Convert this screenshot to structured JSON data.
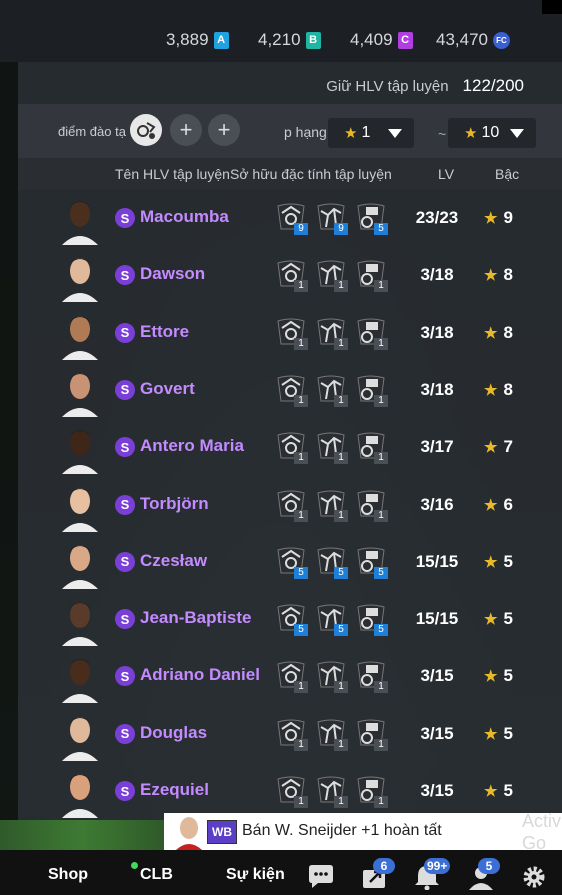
{
  "currencies": [
    {
      "value": "3,889",
      "icon": "A",
      "color": "#1fa3e0"
    },
    {
      "value": "4,210",
      "icon": "B",
      "color": "#1fb5a5"
    },
    {
      "value": "4,409",
      "icon": "C",
      "color": "#b03ee0"
    },
    {
      "value": "43,470",
      "icon": "FC",
      "color": "#3a5fd0"
    }
  ],
  "header": {
    "label": "Giữ HLV tập luyện",
    "count": "122/200"
  },
  "filter": {
    "label": "điểm đào tạ",
    "rank_label": "p hạng",
    "from_value": "1",
    "to_value": "10",
    "separator": "~"
  },
  "columns": {
    "name": "Tên HLV tập luyện",
    "traits": "Sở hữu đặc tính tập luyện",
    "lv": "LV",
    "rank": "Bậc"
  },
  "coaches": [
    {
      "name": "Macoumba",
      "badge": "S",
      "traits": [
        {
          "lvl": "9",
          "c": "#1f7fd6"
        },
        {
          "lvl": "9",
          "c": "#1f7fd6"
        },
        {
          "lvl": "5",
          "c": "#1f7fd6"
        }
      ],
      "lv": "23/23",
      "rank": "9",
      "skin": "#4a2e1e"
    },
    {
      "name": "Dawson",
      "badge": "S",
      "traits": [
        {
          "lvl": "1",
          "c": "#4a4e55"
        },
        {
          "lvl": "1",
          "c": "#4a4e55"
        },
        {
          "lvl": "1",
          "c": "#4a4e55"
        }
      ],
      "lv": "3/18",
      "rank": "8",
      "skin": "#e0b89a"
    },
    {
      "name": "Ettore",
      "badge": "S",
      "traits": [
        {
          "lvl": "1",
          "c": "#4a4e55"
        },
        {
          "lvl": "1",
          "c": "#4a4e55"
        },
        {
          "lvl": "1",
          "c": "#4a4e55"
        }
      ],
      "lv": "3/18",
      "rank": "8",
      "skin": "#b07a55"
    },
    {
      "name": "Govert",
      "badge": "S",
      "traits": [
        {
          "lvl": "1",
          "c": "#4a4e55"
        },
        {
          "lvl": "1",
          "c": "#4a4e55"
        },
        {
          "lvl": "1",
          "c": "#4a4e55"
        }
      ],
      "lv": "3/18",
      "rank": "8",
      "skin": "#c89274"
    },
    {
      "name": "Antero Maria",
      "badge": "S",
      "traits": [
        {
          "lvl": "1",
          "c": "#4a4e55"
        },
        {
          "lvl": "1",
          "c": "#4a4e55"
        },
        {
          "lvl": "1",
          "c": "#4a4e55"
        }
      ],
      "lv": "3/17",
      "rank": "7",
      "skin": "#3e2619"
    },
    {
      "name": "Torbjörn",
      "badge": "S",
      "traits": [
        {
          "lvl": "1",
          "c": "#4a4e55"
        },
        {
          "lvl": "1",
          "c": "#4a4e55"
        },
        {
          "lvl": "1",
          "c": "#4a4e55"
        }
      ],
      "lv": "3/16",
      "rank": "6",
      "skin": "#e6c0a0"
    },
    {
      "name": "Czesław",
      "badge": "S",
      "traits": [
        {
          "lvl": "5",
          "c": "#1f7fd6"
        },
        {
          "lvl": "5",
          "c": "#1f7fd6"
        },
        {
          "lvl": "5",
          "c": "#1f7fd6"
        }
      ],
      "lv": "15/15",
      "rank": "5",
      "skin": "#d9a987"
    },
    {
      "name": "Jean-Baptiste",
      "badge": "S",
      "traits": [
        {
          "lvl": "5",
          "c": "#1f7fd6"
        },
        {
          "lvl": "5",
          "c": "#1f7fd6"
        },
        {
          "lvl": "5",
          "c": "#1f7fd6"
        }
      ],
      "lv": "15/15",
      "rank": "5",
      "skin": "#5a3a28"
    },
    {
      "name": "Adriano Daniel",
      "badge": "S",
      "traits": [
        {
          "lvl": "1",
          "c": "#4a4e55"
        },
        {
          "lvl": "1",
          "c": "#4a4e55"
        },
        {
          "lvl": "1",
          "c": "#4a4e55"
        }
      ],
      "lv": "3/15",
      "rank": "5",
      "skin": "#4a2c1c"
    },
    {
      "name": "Douglas",
      "badge": "S",
      "traits": [
        {
          "lvl": "1",
          "c": "#4a4e55"
        },
        {
          "lvl": "1",
          "c": "#4a4e55"
        },
        {
          "lvl": "1",
          "c": "#4a4e55"
        }
      ],
      "lv": "3/15",
      "rank": "5",
      "skin": "#e0b89a"
    },
    {
      "name": "Ezequiel",
      "badge": "S",
      "traits": [
        {
          "lvl": "1",
          "c": "#4a4e55"
        },
        {
          "lvl": "1",
          "c": "#4a4e55"
        },
        {
          "lvl": "1",
          "c": "#4a4e55"
        }
      ],
      "lv": "3/15",
      "rank": "5",
      "skin": "#d9a07c"
    }
  ],
  "notification": {
    "badge": "WB",
    "text": "Bán W. Sneijder +1 hoàn tất"
  },
  "activate_text": "Activ\nGo to",
  "nav": {
    "shop": "Shop",
    "clb": "CLB",
    "events": "Sự kiện",
    "badge_transfers": "6",
    "badge_notifications": "99+",
    "badge_friends": "5"
  }
}
